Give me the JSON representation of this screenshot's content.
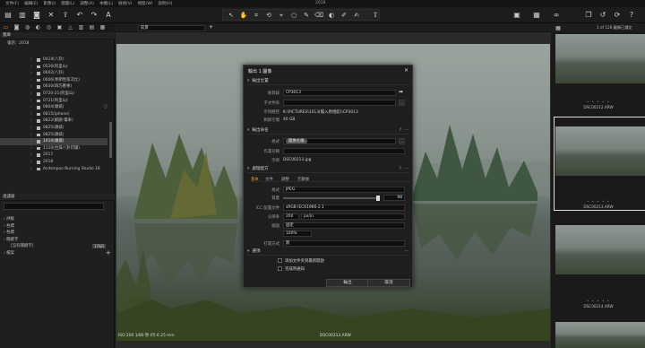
{
  "menubar": {
    "items": [
      "文件(F)",
      "編輯(E)",
      "影像(I)",
      "圖層(L)",
      "調整(A)",
      "本機(L)",
      "檢視(V)",
      "視窗(W)",
      "說明(H)"
    ],
    "title": "2018"
  },
  "viewer": {
    "preset_label": "前景",
    "status_left": "ISO 200 1/80 秒 f/5.6 25 mm",
    "status_center": "DSC00213.ARW"
  },
  "left": {
    "library_head": "圖庫",
    "session_label": "會話：2018",
    "folders": [
      "0414(八卦)",
      "0526(阿里山)",
      "0602(八卦)",
      "0606(季節性第次比)",
      "0630(四巧應事)",
      "0720-21(阿里山)",
      "0721(阿里山)",
      "0804(頭城)",
      "0815(iphone)",
      "0822(解題-電車)",
      "0825(頭城)",
      "0825(頭城)",
      "1010(頭城)",
      "1110(台灣八卦印講)",
      "2017",
      "2018",
      "Acdsmpoo Burning Studio 16"
    ],
    "selected_folder": "1010(頭城)",
    "filter_head": "過濾器",
    "filter_items": [
      "評級",
      "色標",
      "色標",
      "關鍵字"
    ],
    "keyword_badge": "17&R",
    "keyword_sub": "[沒有關鍵字]",
    "folder_row": "檔案",
    "filter_search_placeholder": "搜尋"
  },
  "dialog": {
    "title": "輸出 1 圖像",
    "sec_location": "輸出位置",
    "lbl_root": "根目錄",
    "root_value": "CP3013",
    "lbl_subfolder": "子文件夾",
    "lbl_output_path": "示例路徑",
    "output_path": "K:\\PICTURES\\1013(陽入原相館)\\CP3013",
    "lbl_free_space": "剩餘空間",
    "free_space": "40 GB",
    "sec_naming": "輸出命名",
    "lbl_format": "格式",
    "format_token": "圖像名稱",
    "lbl_job_name": "作業名稱",
    "lbl_example": "示例",
    "example_name": "DSC00213.jpg",
    "sec_recipe": "處理配方",
    "recipe_tabs": [
      "基本",
      "文件",
      "調整",
      "元數據"
    ],
    "lbl_format2": "格式",
    "format2": "JPEG",
    "lbl_quality": "質量",
    "quality": "98",
    "lbl_icc": "ICC 配置文件",
    "icc": "sRGB IEC61966-2.1",
    "lbl_resolution": "分辨率",
    "resolution": "200",
    "resolution_unit": "px/in",
    "lbl_scale": "縮放",
    "scale_mode": "固定",
    "scale_value": "100%",
    "lbl_open_with": "打開方式",
    "open_with": "無",
    "sec_options": "選項",
    "opt1": "添加文件夾到最新開啟",
    "opt2": "完成時通知",
    "btn_output": "輸出",
    "btn_cancel": "取消"
  },
  "filmstrip": {
    "counter": "1 of 126 圖像已選定",
    "items": [
      "DSC00212.ARW",
      "DSC00213.ARW",
      "DSC00214.ARW"
    ],
    "selected": "DSC00213.ARW"
  }
}
